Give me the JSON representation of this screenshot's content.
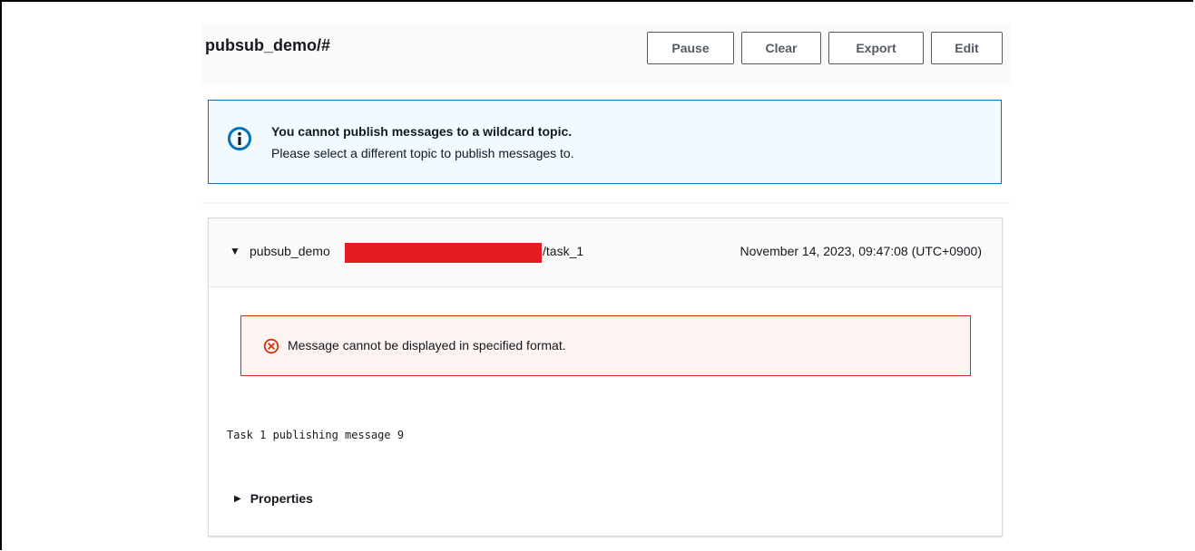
{
  "header": {
    "title": "pubsub_demo/#",
    "buttons": {
      "pause": "Pause",
      "clear": "Clear",
      "export": "Export",
      "edit": "Edit"
    }
  },
  "info_alert": {
    "icon": "info-icon",
    "title": "You cannot publish messages to a wildcard topic.",
    "body": "Please select a different topic to publish messages to."
  },
  "message": {
    "topic_prefix": "pubsub_demo",
    "topic_suffix": "/task_1",
    "timestamp": "November 14, 2023, 09:47:08 (UTC+0900)",
    "error_icon": "error-circle-icon",
    "error_text": "Message cannot be displayed in specified format.",
    "payload": "Task 1 publishing message 9",
    "properties_label": "Properties"
  },
  "colors": {
    "info_border": "#0073bb",
    "info_bg": "#f1faff",
    "error_border": "#d13212",
    "error_bg": "#fdf3f1",
    "redaction": "#e31b23"
  }
}
